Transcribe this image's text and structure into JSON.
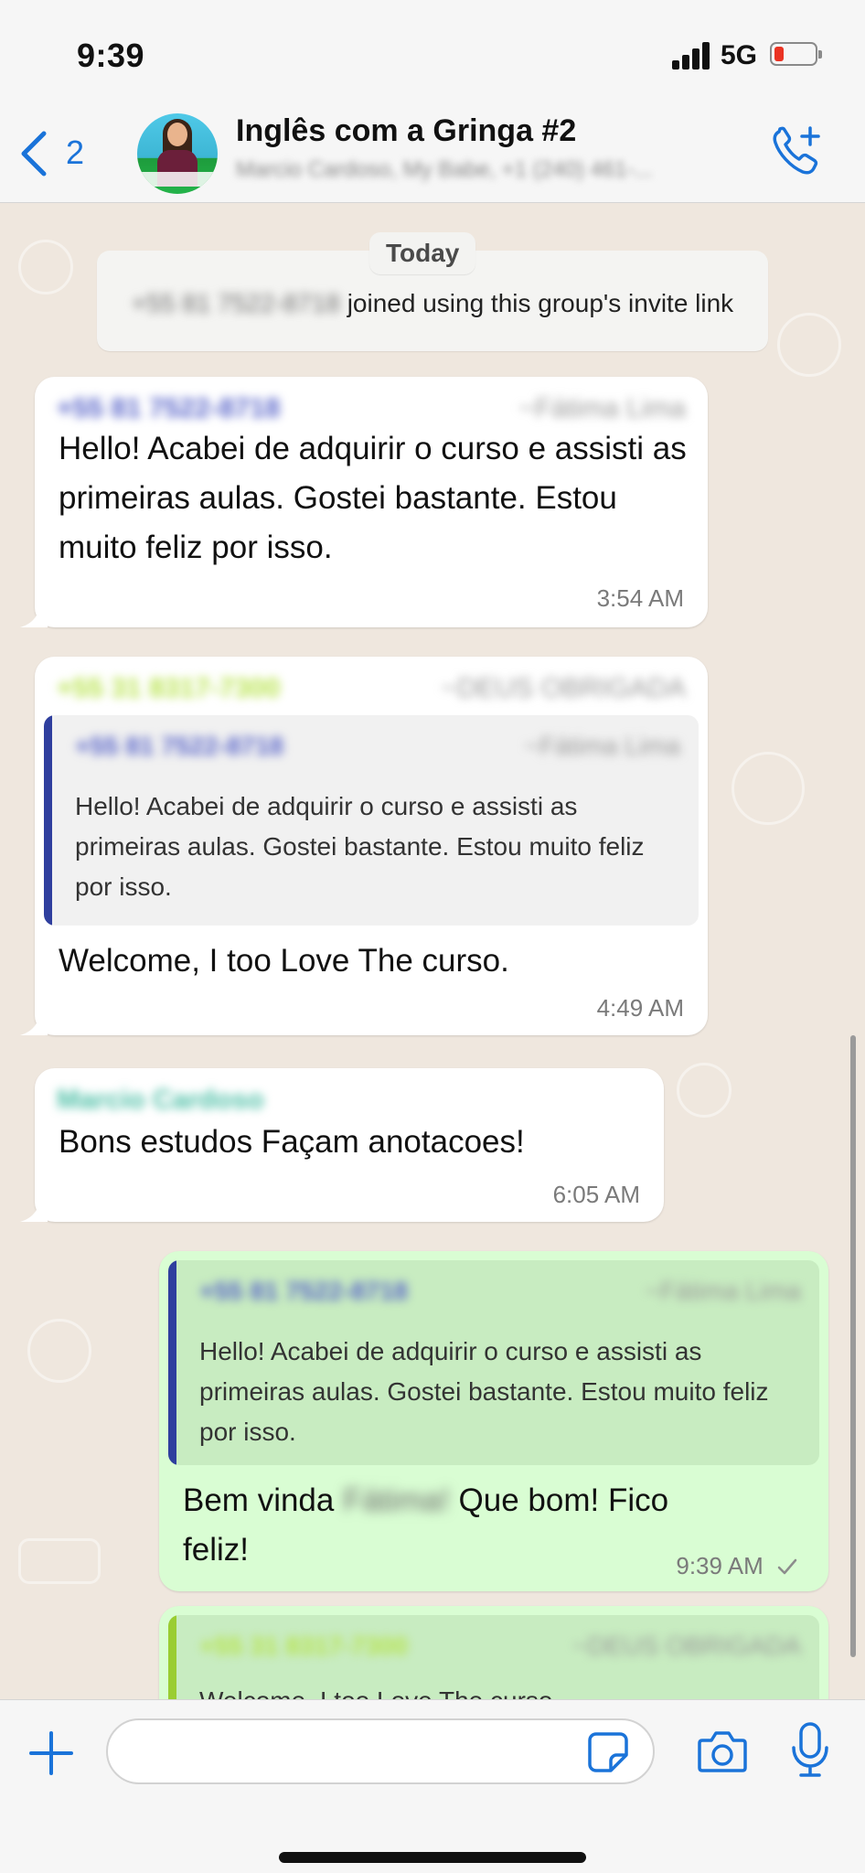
{
  "status_bar": {
    "time": "9:39",
    "network": "5G",
    "battery_level": 0.15
  },
  "header": {
    "back_count": "2",
    "title": "Inglês com a Gringa #2",
    "subtitle": "Marcio Cardoso, My Babe, +1 (240) 461-..."
  },
  "chat": {
    "date_label": "Today",
    "system_message": {
      "blurred_number": "+55 81 7522-8718",
      "text": "joined using this group's invite link"
    },
    "messages": [
      {
        "sender_number": "+55 81 7522-8718",
        "sender_alias": "~Fátima Lima",
        "text": "Hello! Acabei de adquirir o curso e assisti as primeiras aulas. Gostei bastante. Estou muito feliz por isso.",
        "time": "3:54 AM"
      },
      {
        "sender_number": "+55 31 8317-7300",
        "sender_alias": "~DEUS OBRIGADA",
        "quote": {
          "sender_number": "+55 81 7522-8718",
          "sender_alias": "~Fátima Lima",
          "text": "Hello! Acabei de adquirir o curso e assisti as primeiras aulas. Gostei bastante. Estou muito feliz por isso."
        },
        "text": "Welcome,  I too Love The curso.",
        "time": "4:49 AM"
      },
      {
        "sender_name": "Marcio Cardoso",
        "text": "Bons estudos Façam anotacoes!",
        "time": "6:05 AM"
      },
      {
        "outgoing": true,
        "quote": {
          "sender_number": "+55 81 7522-8718",
          "sender_alias": "~Fátima Lima",
          "text": "Hello! Acabei de adquirir o curso e assisti as primeiras aulas. Gostei bastante. Estou muito feliz por isso."
        },
        "text_before": "Bem vinda",
        "hidden_name": "Fátima!",
        "text_after": "Que bom! Fico",
        "text_line2": "feliz!",
        "time": "9:39 AM"
      },
      {
        "outgoing": true,
        "quote": {
          "sender_number": "+55 31 8317-7300",
          "sender_alias": "~DEUS OBRIGADA",
          "text": "Welcome,  I too Love The curso."
        }
      }
    ]
  },
  "input_bar": {
    "placeholder": ""
  },
  "colors": {
    "accent": "#1a73d9",
    "outgoing_bubble": "#d9fdd3",
    "chat_background": "#efe7de",
    "quote_bar_blue": "#2f3f9e",
    "quote_bar_green": "#9acd32",
    "sender_green": "#b7e34a",
    "sender_purple": "#5864c9",
    "sender_teal": "#4cbfa6"
  },
  "icons": [
    "back-chevron-icon",
    "add-call-icon",
    "plus-icon",
    "sticker-icon",
    "camera-icon",
    "mic-icon",
    "double-check-icon"
  ]
}
